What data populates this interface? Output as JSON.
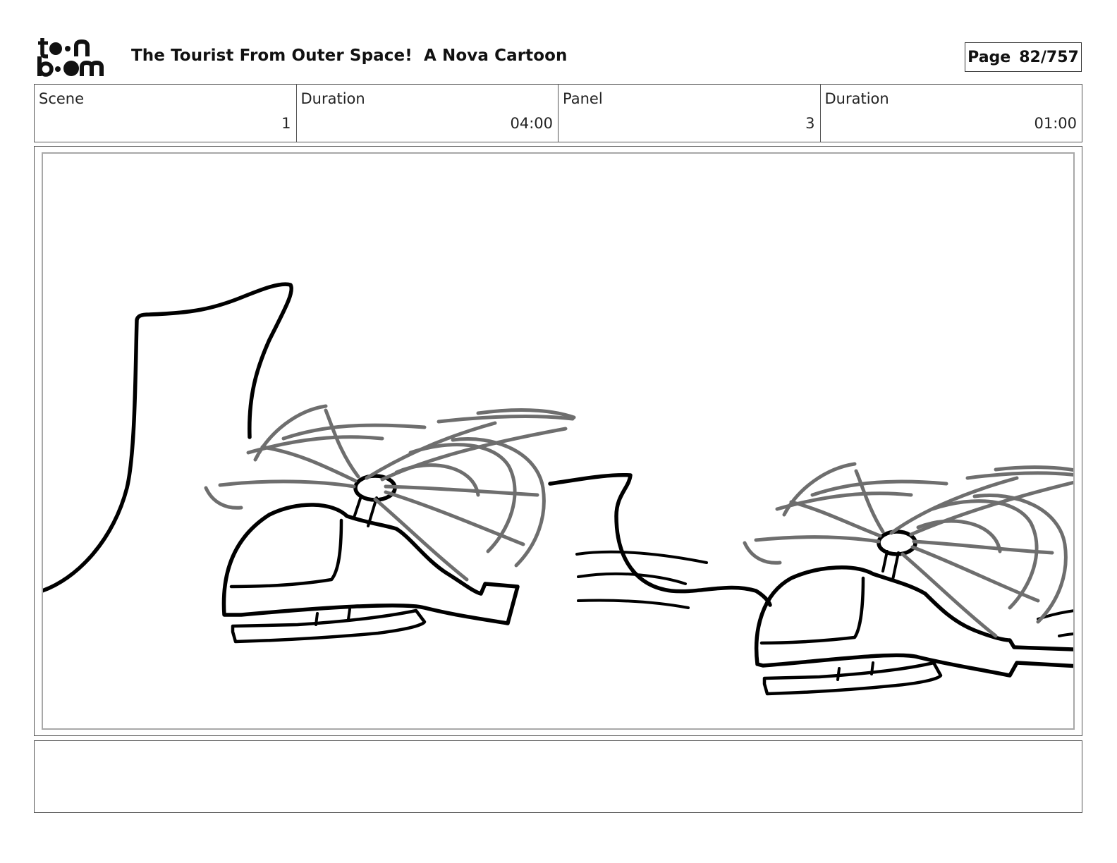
{
  "header": {
    "logo_text": "toon boom",
    "title": "The Tourist From Outer Space!  A Nova Cartoon",
    "page_label": "Page",
    "page_value": "82/757"
  },
  "info": [
    {
      "label": "Scene",
      "value": "1"
    },
    {
      "label": "Duration",
      "value": "04:00"
    },
    {
      "label": "Panel",
      "value": "3"
    },
    {
      "label": "Duration",
      "value": "01:00"
    }
  ],
  "notes": {
    "text": ""
  },
  "colors": {
    "ink": "#000000",
    "blur": "#6e6e6e",
    "frame": "#a8a8a8"
  }
}
